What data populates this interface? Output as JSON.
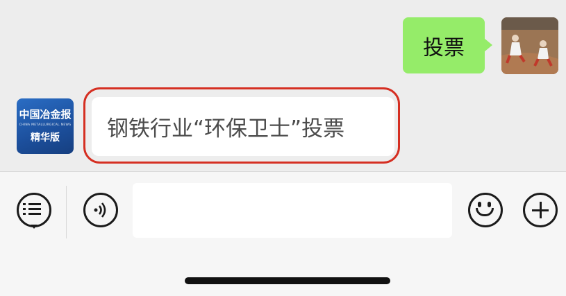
{
  "chat": {
    "outgoing_message": "投票",
    "incoming_message": "钢铁行业“环保卫士”投票",
    "sender_avatar": {
      "logo_text": "中国冶金报",
      "subtitle": "CHINA METALLURGICAL NEWS",
      "edition": "精华版"
    },
    "highlight_color": "#d52f22",
    "outgoing_bubble_color": "#95ec69"
  },
  "input_bar": {
    "menu_icon": "menu-list-icon",
    "voice_icon": "voice-icon",
    "emoji_icon": "emoji-icon",
    "plus_icon": "plus-icon",
    "text_value": ""
  }
}
